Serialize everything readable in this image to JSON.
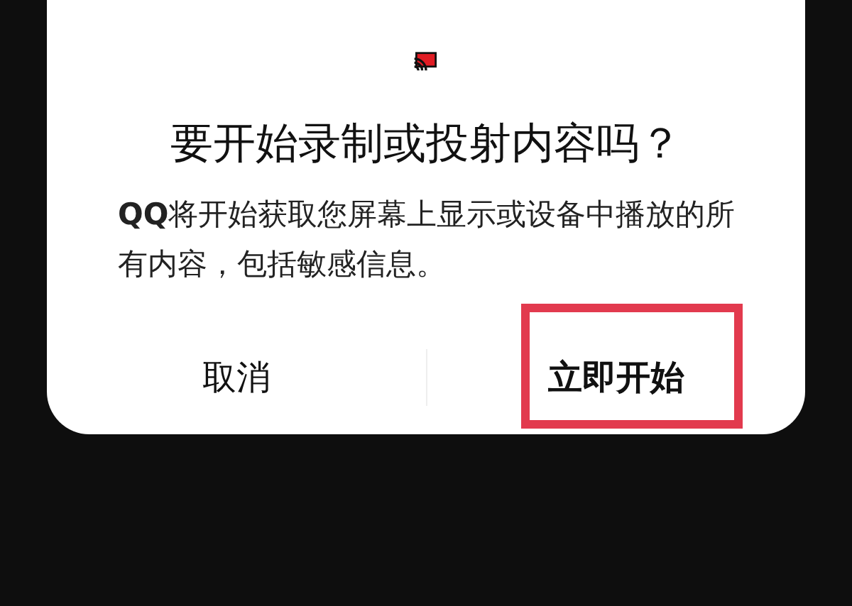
{
  "dialog": {
    "title": "要开始录制或投射内容吗？",
    "message": "**QQ**将开始获取您屏幕上显示或设备中播放的所有内容，包括敏感信息。",
    "buttons": [
      {
        "label": "取消",
        "kind": "cancel",
        "highlighted": false
      },
      {
        "label": "立即开始",
        "kind": "confirm",
        "highlighted": true
      }
    ]
  }
}
